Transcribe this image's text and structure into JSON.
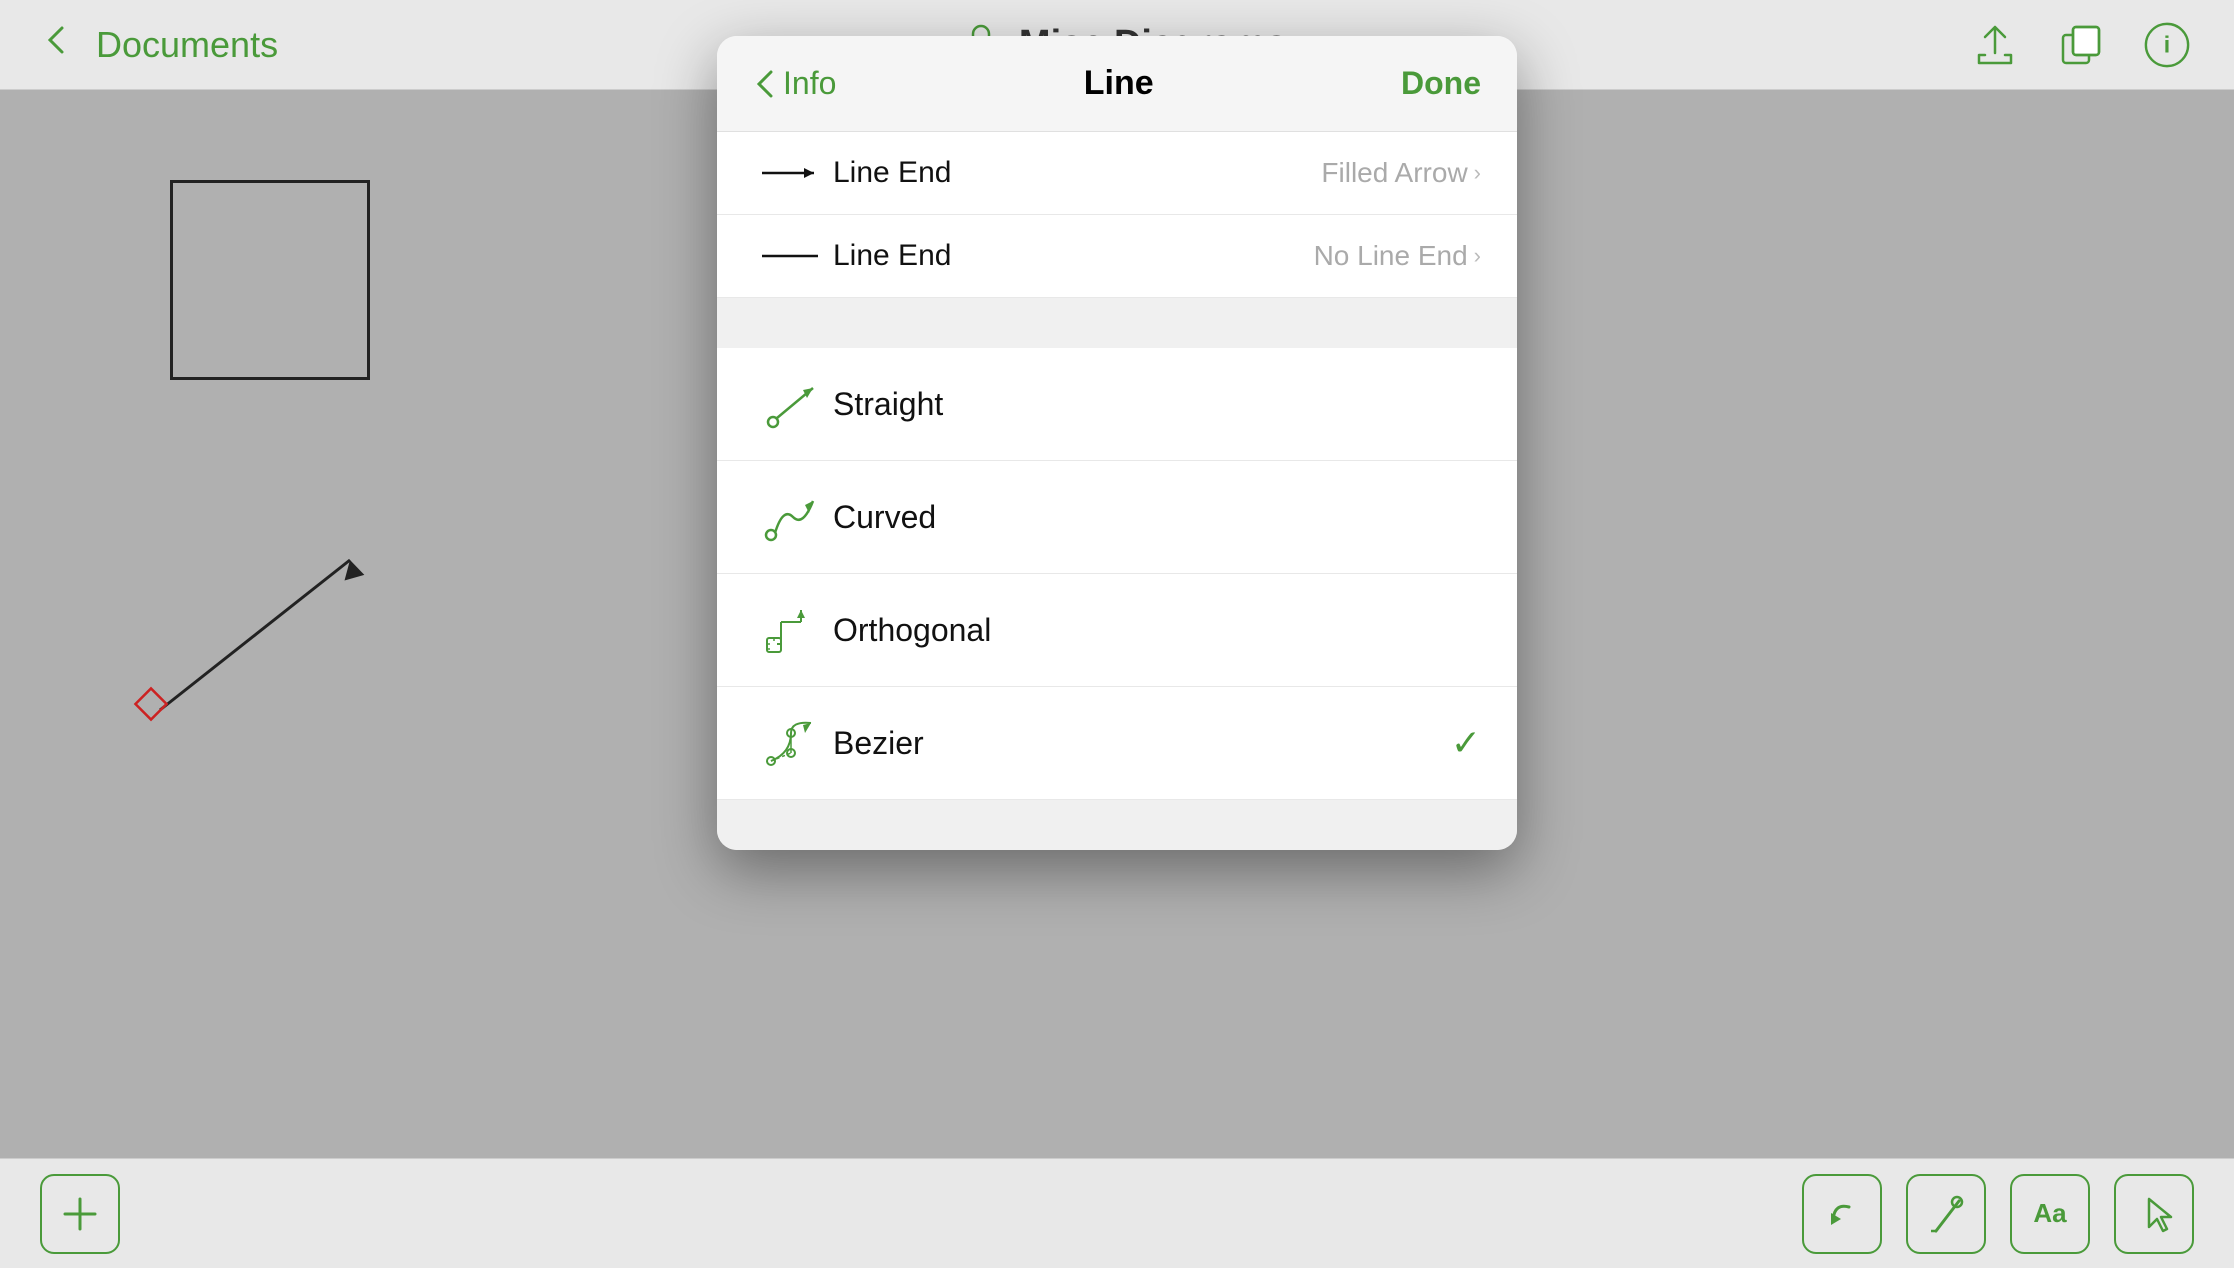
{
  "app": {
    "title": "Misc Diagrams",
    "back_label": "Documents"
  },
  "toolbar": {
    "back_icon": "←",
    "lock_icon": "🔒",
    "share_icon": "⬆",
    "copy_icon": "⧉",
    "info_icon": "ℹ"
  },
  "bottom_toolbar": {
    "add_label": "+",
    "undo_icon": "↩",
    "pen_icon": "✒",
    "text_icon": "Aa",
    "pointer_icon": "☞"
  },
  "modal": {
    "back_label": "Info",
    "title": "Line",
    "done_label": "Done",
    "line_end_rows": [
      {
        "id": "line-end-arrow",
        "label": "Line End",
        "value": "Filled Arrow",
        "icon_type": "arrow"
      },
      {
        "id": "line-end-none",
        "label": "Line End",
        "value": "No Line End",
        "icon_type": "line"
      }
    ],
    "connection_types": [
      {
        "id": "straight",
        "label": "Straight",
        "icon_type": "straight",
        "selected": false
      },
      {
        "id": "curved",
        "label": "Curved",
        "icon_type": "curved",
        "selected": false
      },
      {
        "id": "orthogonal",
        "label": "Orthogonal",
        "icon_type": "orthogonal",
        "selected": false
      },
      {
        "id": "bezier",
        "label": "Bezier",
        "icon_type": "bezier",
        "selected": true
      }
    ]
  },
  "colors": {
    "green": "#4a9a3a",
    "text_primary": "#111111",
    "text_secondary": "#aaaaaa",
    "background": "#b0b0b0",
    "modal_bg": "#ffffff",
    "divider": "#f0f0f0"
  }
}
